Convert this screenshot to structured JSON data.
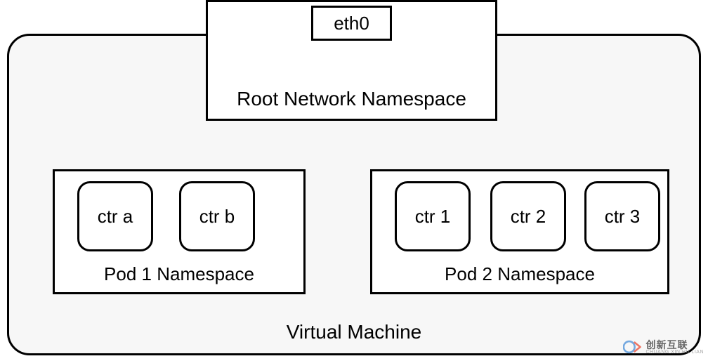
{
  "vm": {
    "label": "Virtual Machine"
  },
  "root_ns": {
    "label": "Root Network Namespace",
    "interface": "eth0"
  },
  "pods": {
    "pod1": {
      "label": "Pod 1 Namespace",
      "containers": {
        "a": "ctr a",
        "b": "ctr b"
      }
    },
    "pod2": {
      "label": "Pod 2 Namespace",
      "containers": {
        "c1": "ctr 1",
        "c2": "ctr 2",
        "c3": "ctr 3"
      }
    }
  },
  "watermark": {
    "main": "创新互联",
    "sub": "CHUANG XIN HU LIAN"
  }
}
